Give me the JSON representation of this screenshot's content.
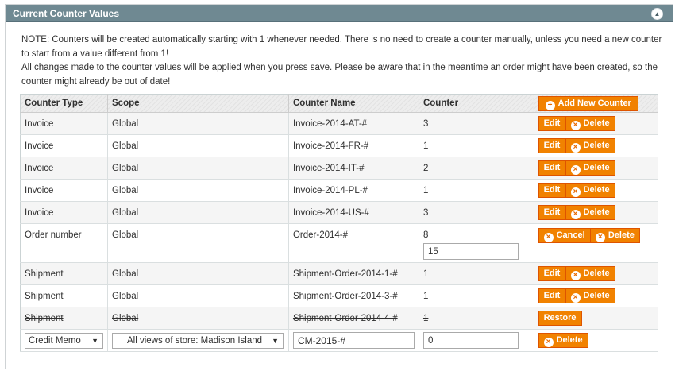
{
  "panel": {
    "title": "Current Counter Values"
  },
  "note": {
    "line1": "NOTE: Counters will be created automatically starting with 1 whenever needed. There is no need to create a counter manually, unless you need a new counter to start from a value different from 1!",
    "line2": "All changes made to the counter values will be applied when you press save. Please be aware that in the meantime an order might have been created, so the counter might already be out of date!"
  },
  "table": {
    "headers": {
      "type": "Counter Type",
      "scope": "Scope",
      "name": "Counter Name",
      "counter": "Counter"
    },
    "add_button": "Add New Counter",
    "rows": [
      {
        "type": "Invoice",
        "scope": "Global",
        "name": "Invoice-2014-AT-#",
        "counter": "3",
        "edit": "Edit",
        "delete": "Delete"
      },
      {
        "type": "Invoice",
        "scope": "Global",
        "name": "Invoice-2014-FR-#",
        "counter": "1",
        "edit": "Edit",
        "delete": "Delete"
      },
      {
        "type": "Invoice",
        "scope": "Global",
        "name": "Invoice-2014-IT-#",
        "counter": "2",
        "edit": "Edit",
        "delete": "Delete"
      },
      {
        "type": "Invoice",
        "scope": "Global",
        "name": "Invoice-2014-PL-#",
        "counter": "1",
        "edit": "Edit",
        "delete": "Delete"
      },
      {
        "type": "Invoice",
        "scope": "Global",
        "name": "Invoice-2014-US-#",
        "counter": "3",
        "edit": "Edit",
        "delete": "Delete"
      },
      {
        "type": "Order number",
        "scope": "Global",
        "name": "Order-2014-#",
        "counter": "8",
        "input_value": "15",
        "cancel": "Cancel",
        "delete": "Delete"
      },
      {
        "type": "Shipment",
        "scope": "Global",
        "name": "Shipment-Order-2014-1-#",
        "counter": "1",
        "edit": "Edit",
        "delete": "Delete"
      },
      {
        "type": "Shipment",
        "scope": "Global",
        "name": "Shipment-Order-2014-3-#",
        "counter": "1",
        "edit": "Edit",
        "delete": "Delete"
      },
      {
        "type": "Shipment",
        "scope": "Global",
        "name": "Shipment-Order-2014-4-#",
        "counter": "1",
        "restore": "Restore"
      }
    ],
    "new_row": {
      "type_select": "Credit Memo",
      "scope_select": "All views of store: Madison Island",
      "name_value": "CM-2015-#",
      "counter_value": "0",
      "delete": "Delete"
    }
  },
  "colors": {
    "header_bar": "#6f8992",
    "button": "#f18200",
    "button_border": "#de5400"
  },
  "icons": [
    "collapse-arrow-icon",
    "plus-circle-icon",
    "delete-x-icon",
    "dropdown-arrow-icon"
  ]
}
